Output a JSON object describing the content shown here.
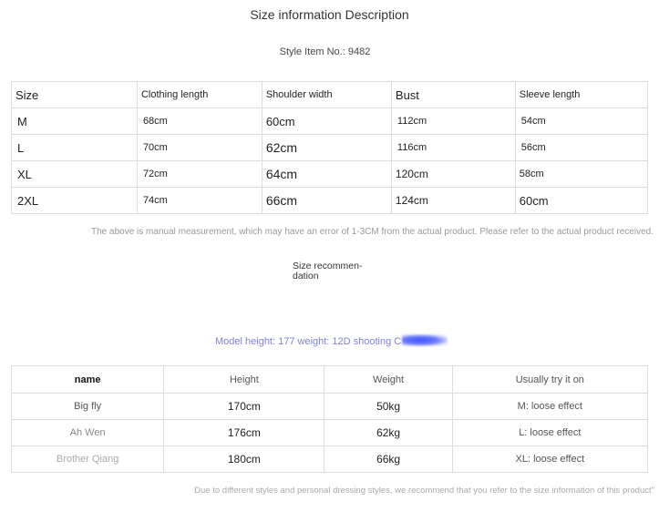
{
  "title": "Size information Description",
  "style_item": "Style Item No.: 9482",
  "size_table": {
    "headers": [
      "Size",
      "Clothing length",
      "Shoulder width",
      "Bust",
      "Sleeve length"
    ],
    "rows": [
      [
        "M",
        "68cm",
        "60cm",
        "112cm",
        "54cm"
      ],
      [
        "L",
        "70cm",
        "62cm",
        "116cm",
        "56cm"
      ],
      [
        "XL",
        "72cm",
        "64cm",
        "120cm",
        "58cm"
      ],
      [
        "2XL",
        "74cm",
        "66cm",
        "124cm",
        "60cm"
      ]
    ]
  },
  "measurement_note": "The above is manual measurement, which may have an error of 1-3CM from the actual product. Please refer to the actual product received.",
  "recommendation": {
    "line1": "Size recommen-",
    "line2": "dation"
  },
  "model_info": "Model height: 177 weight: 12D shooting C",
  "model_table": {
    "headers": [
      "name",
      "Height",
      "Weight",
      "Usually try it on"
    ],
    "rows": [
      [
        "Big fly",
        "170cm",
        "50kg",
        "M: loose effect"
      ],
      [
        "Ah Wen",
        "176cm",
        "62kg",
        "L: loose effect"
      ],
      [
        "Brother Qiang",
        "180cm",
        "66kg",
        "XL: loose effect"
      ]
    ]
  },
  "footer_note": "Due to different styles and personal dressing styles, we recommend that you refer to the size information of this product\""
}
